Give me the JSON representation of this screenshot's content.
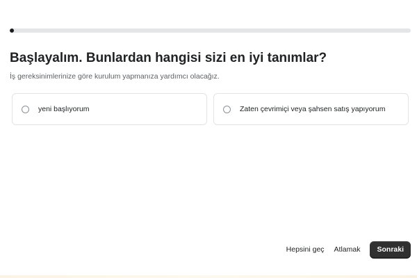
{
  "progress": {
    "value_percent": 1
  },
  "header": {
    "title": "Başlayalım. Bunlardan hangisi sizi en iyi tanımlar?",
    "subtitle": "İş gereksinimlerinize göre kurulum yapmanıza yardımcı olacağız."
  },
  "options": [
    {
      "label": "yeni başlıyorum",
      "selected": false
    },
    {
      "label": "Zaten çevrimiçi veya şahsen satış yapıyorum",
      "selected": false
    }
  ],
  "footer": {
    "skip_all_label": "Hepsini geç",
    "skip_label": "Atlamak",
    "next_label": "Sonraki"
  },
  "colors": {
    "progress_fill": "#1a1c1d",
    "primary_button": "#303030"
  }
}
